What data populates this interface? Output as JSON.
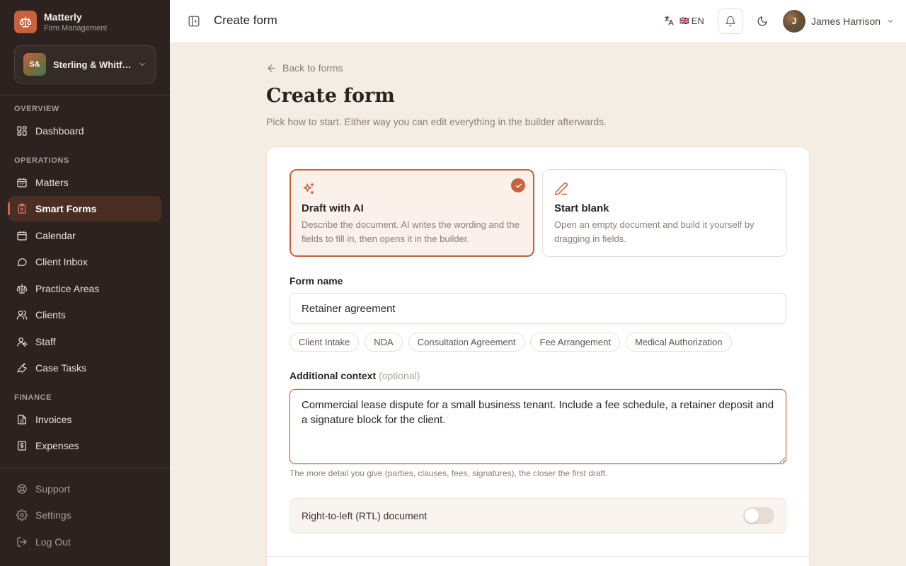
{
  "app": {
    "name": "Matterly",
    "subtitle": "Firm Management"
  },
  "firm": {
    "initials": "S&",
    "name": "Sterling & Whitfield"
  },
  "sidebar": {
    "sections": [
      {
        "label": "OVERVIEW"
      },
      {
        "label": "OPERATIONS"
      },
      {
        "label": "FINANCE"
      }
    ],
    "items": [
      {
        "label": "Dashboard",
        "icon": "dashboard-icon"
      },
      {
        "label": "Matters",
        "icon": "calendar-icon"
      },
      {
        "label": "Smart Forms",
        "icon": "clipboard-icon",
        "active": true
      },
      {
        "label": "Calendar",
        "icon": "calendar-icon"
      },
      {
        "label": "Client Inbox",
        "icon": "chat-icon"
      },
      {
        "label": "Practice Areas",
        "icon": "scales-icon"
      },
      {
        "label": "Clients",
        "icon": "users-icon"
      },
      {
        "label": "Staff",
        "icon": "staff-icon"
      },
      {
        "label": "Case Tasks",
        "icon": "wrench-icon"
      },
      {
        "label": "Invoices",
        "icon": "document-icon"
      },
      {
        "label": "Expenses",
        "icon": "dollar-doc-icon"
      }
    ],
    "footer": [
      {
        "label": "Support",
        "icon": "lifebuoy-icon"
      },
      {
        "label": "Settings",
        "icon": "gear-icon"
      },
      {
        "label": "Log Out",
        "icon": "logout-icon"
      }
    ]
  },
  "topbar": {
    "title": "Create form",
    "language": "EN",
    "language_flag": "🇬🇧",
    "user": {
      "name": "James Harrison",
      "initial": "J"
    }
  },
  "main": {
    "back_label": "Back to forms",
    "title": "Create form",
    "subtitle": "Pick how to start. Either way you can edit everything in the builder afterwards.",
    "options": [
      {
        "title": "Draft with AI",
        "description": "Describe the document. AI writes the wording and the fields to fill in, then opens it in the builder.",
        "selected": true
      },
      {
        "title": "Start blank",
        "description": "Open an empty document and build it yourself by dragging in fields.",
        "selected": false
      }
    ],
    "form_name_label": "Form name",
    "form_name_value": "Retainer agreement",
    "templates": [
      "Client Intake",
      "NDA",
      "Consultation Agreement",
      "Fee Arrangement",
      "Medical Authorization"
    ],
    "context_label": "Additional context",
    "context_optional": "(optional)",
    "context_value": "Commercial lease dispute for a small business tenant. Include a fee schedule, a retainer deposit and a signature block for the client.",
    "context_hint": "The more detail you give (parties, clauses, fees, signatures), the closer the first draft.",
    "rtl_label": "Right-to-left (RTL) document",
    "rtl_enabled": false
  },
  "colors": {
    "accent": "#c8613d",
    "sidebar_bg": "#2c2320",
    "page_bg": "#f4ede4"
  }
}
